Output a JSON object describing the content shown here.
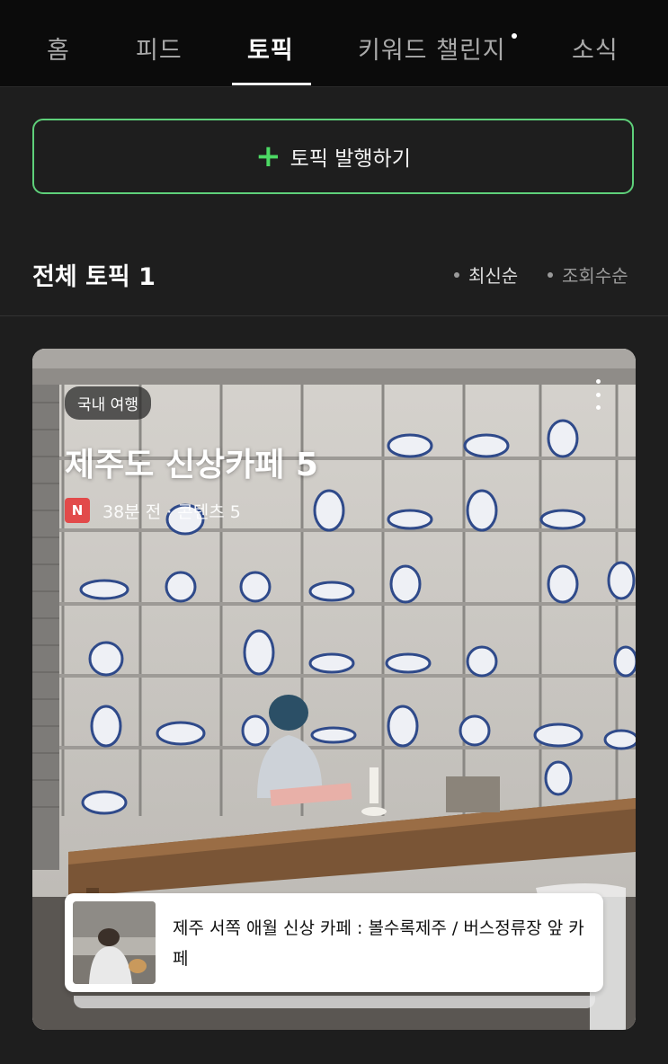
{
  "tabs": [
    {
      "label": "홈",
      "active": false
    },
    {
      "label": "피드",
      "active": false
    },
    {
      "label": "토픽",
      "active": true
    },
    {
      "label": "키워드 챌린지",
      "active": false,
      "new_dot": true
    },
    {
      "label": "소식",
      "active": false
    }
  ],
  "publish_button": {
    "icon": "plus-icon",
    "label": "토픽 발행하기"
  },
  "section": {
    "title": "전체 토픽 1",
    "sort_options": [
      {
        "label": "최신순",
        "selected": true
      },
      {
        "label": "조회수순",
        "selected": false
      }
    ]
  },
  "topic_card": {
    "category": "국내 여행",
    "title": "제주도 신상카페 5",
    "source_icon": "N",
    "meta": "38분 전 · 콘텐츠 5",
    "content_item": {
      "title": "제주 서쪽 애월 신상 카페 : 볼수록제주 / 버스정류장 앞 카페"
    }
  },
  "colors": {
    "accent_green": "#4cd964",
    "background": "#1e1e1e",
    "tab_bar": "#0b0b0b",
    "source_badge": "#e24a4a"
  }
}
